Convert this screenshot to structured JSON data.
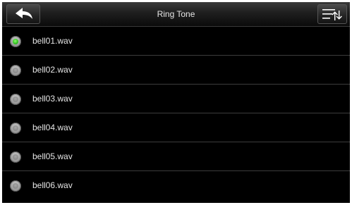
{
  "header": {
    "title": "Ring Tone",
    "back_icon": "back-arrow-icon",
    "menu_icon": "sort-menu-icon"
  },
  "list": {
    "items": [
      {
        "label": "bell01.wav",
        "selected": true
      },
      {
        "label": "bell02.wav",
        "selected": false
      },
      {
        "label": "bell03.wav",
        "selected": false
      },
      {
        "label": "bell04.wav",
        "selected": false
      },
      {
        "label": "bell05.wav",
        "selected": false
      },
      {
        "label": "bell06.wav",
        "selected": false
      }
    ]
  },
  "colors": {
    "background": "#000000",
    "text": "#e6e6e6",
    "selected_indicator": "#2fbf1f",
    "divider": "#3c3c3c"
  }
}
